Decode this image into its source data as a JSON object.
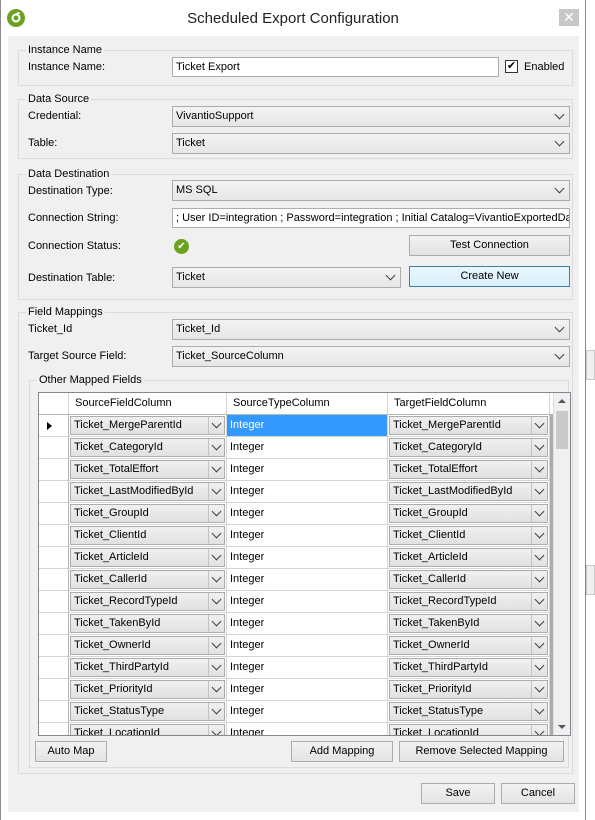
{
  "window": {
    "title": "Scheduled Export Configuration",
    "close_glyph": "✕"
  },
  "instance": {
    "group_title": "Instance Name",
    "name_label": "Instance Name:",
    "name_value": "Ticket Export",
    "enabled_label": "Enabled",
    "enabled_checked": true
  },
  "source": {
    "group_title": "Data Source",
    "credential_label": "Credential:",
    "credential_value": "VivantioSupport",
    "table_label": "Table:",
    "table_value": "Ticket"
  },
  "destination": {
    "group_title": "Data Destination",
    "type_label": "Destination Type:",
    "type_value": "MS SQL",
    "conn_label": "Connection String:",
    "conn_value": "; User ID=integration ; Password=integration ; Initial Catalog=VivantioExportedData",
    "status_label": "Connection Status:",
    "status_icon": "check-circle-icon",
    "test_button": "Test Connection",
    "table_label": "Destination Table:",
    "table_value": "Ticket",
    "create_button": "Create New"
  },
  "mappings": {
    "group_title": "Field Mappings",
    "id_label": "Ticket_Id",
    "id_value": "Ticket_Id",
    "target_label": "Target Source Field:",
    "target_value": "Ticket_SourceColumn",
    "other_title": "Other Mapped Fields",
    "columns": [
      "SourceFieldColumn",
      "SourceTypeColumn",
      "TargetFieldColumn"
    ],
    "rows": [
      {
        "source": "Ticket_MergeParentId",
        "type": "Integer",
        "target": "Ticket_MergeParentId"
      },
      {
        "source": "Ticket_CategoryId",
        "type": "Integer",
        "target": "Ticket_CategoryId"
      },
      {
        "source": "Ticket_TotalEffort",
        "type": "Integer",
        "target": "Ticket_TotalEffort"
      },
      {
        "source": "Ticket_LastModifiedById",
        "type": "Integer",
        "target": "Ticket_LastModifiedById"
      },
      {
        "source": "Ticket_GroupId",
        "type": "Integer",
        "target": "Ticket_GroupId"
      },
      {
        "source": "Ticket_ClientId",
        "type": "Integer",
        "target": "Ticket_ClientId"
      },
      {
        "source": "Ticket_ArticleId",
        "type": "Integer",
        "target": "Ticket_ArticleId"
      },
      {
        "source": "Ticket_CallerId",
        "type": "Integer",
        "target": "Ticket_CallerId"
      },
      {
        "source": "Ticket_RecordTypeId",
        "type": "Integer",
        "target": "Ticket_RecordTypeId"
      },
      {
        "source": "Ticket_TakenById",
        "type": "Integer",
        "target": "Ticket_TakenById"
      },
      {
        "source": "Ticket_OwnerId",
        "type": "Integer",
        "target": "Ticket_OwnerId"
      },
      {
        "source": "Ticket_ThirdPartyId",
        "type": "Integer",
        "target": "Ticket_ThirdPartyId"
      },
      {
        "source": "Ticket_PriorityId",
        "type": "Integer",
        "target": "Ticket_PriorityId"
      },
      {
        "source": "Ticket_StatusType",
        "type": "Integer",
        "target": "Ticket_StatusType"
      },
      {
        "source": "Ticket_LocationId",
        "type": "Integer",
        "target": "Ticket_LocationId"
      }
    ],
    "auto_map_button": "Auto Map",
    "add_button": "Add Mapping",
    "remove_button": "Remove Selected Mapping"
  },
  "footer": {
    "save_button": "Save",
    "cancel_button": "Cancel"
  },
  "colors": {
    "accent_green": "#6aa220",
    "selection_blue": "#3399ff"
  }
}
